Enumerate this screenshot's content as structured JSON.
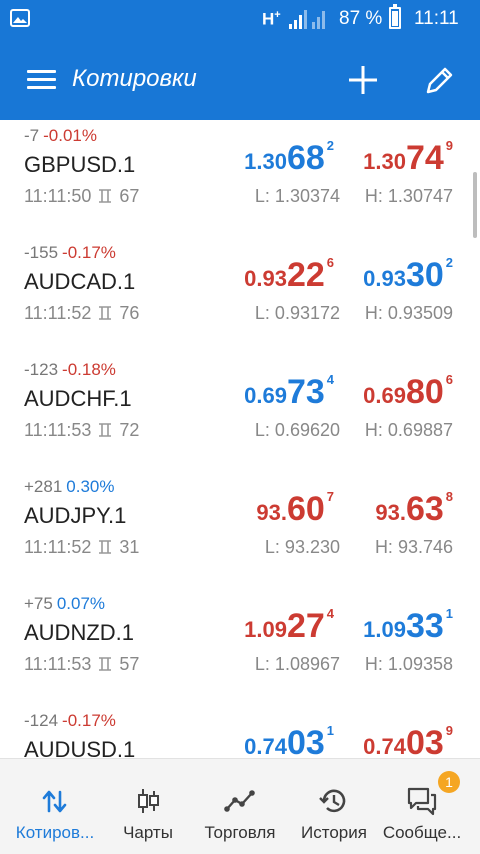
{
  "status_bar": {
    "network": "H",
    "network_plus": "+",
    "battery_percent": "87 %",
    "time": "11:11"
  },
  "toolbar": {
    "title": "Котировки",
    "icons": [
      "menu-icon",
      "plus-icon",
      "pencil-icon"
    ]
  },
  "quotes": [
    {
      "symbol": "GBPUSD.1",
      "change_points": "-7",
      "change_pct": "-0.01%",
      "change_dir": "down",
      "time": "11:11:50",
      "spread": "67",
      "bid": {
        "pre": "1.30",
        "big": "68",
        "sup": "2",
        "color": "blue"
      },
      "ask": {
        "pre": "1.30",
        "big": "74",
        "sup": "9",
        "color": "red"
      },
      "low": "L: 1.30374",
      "high": "H: 1.30747"
    },
    {
      "symbol": "AUDCAD.1",
      "change_points": "-155",
      "change_pct": "-0.17%",
      "change_dir": "down",
      "time": "11:11:52",
      "spread": "76",
      "bid": {
        "pre": "0.93",
        "big": "22",
        "sup": "6",
        "color": "red"
      },
      "ask": {
        "pre": "0.93",
        "big": "30",
        "sup": "2",
        "color": "blue"
      },
      "low": "L: 0.93172",
      "high": "H: 0.93509"
    },
    {
      "symbol": "AUDCHF.1",
      "change_points": "-123",
      "change_pct": "-0.18%",
      "change_dir": "down",
      "time": "11:11:53",
      "spread": "72",
      "bid": {
        "pre": "0.69",
        "big": "73",
        "sup": "4",
        "color": "blue"
      },
      "ask": {
        "pre": "0.69",
        "big": "80",
        "sup": "6",
        "color": "red"
      },
      "low": "L: 0.69620",
      "high": "H: 0.69887"
    },
    {
      "symbol": "AUDJPY.1",
      "change_points": "+281",
      "change_pct": "0.30%",
      "change_dir": "up",
      "time": "11:11:52",
      "spread": "31",
      "bid": {
        "pre": "93.",
        "big": "60",
        "sup": "7",
        "color": "red"
      },
      "ask": {
        "pre": "93.",
        "big": "63",
        "sup": "8",
        "color": "red"
      },
      "low": "L: 93.230",
      "high": "H: 93.746"
    },
    {
      "symbol": "AUDNZD.1",
      "change_points": "+75",
      "change_pct": "0.07%",
      "change_dir": "up",
      "time": "11:11:53",
      "spread": "57",
      "bid": {
        "pre": "1.09",
        "big": "27",
        "sup": "4",
        "color": "red"
      },
      "ask": {
        "pre": "1.09",
        "big": "33",
        "sup": "1",
        "color": "blue"
      },
      "low": "L: 1.08967",
      "high": "H: 1.09358"
    },
    {
      "symbol": "AUDUSD.1",
      "change_points": "-124",
      "change_pct": "-0.17%",
      "change_dir": "down",
      "time": "",
      "spread": "",
      "bid": {
        "pre": "0.74",
        "big": "03",
        "sup": "1",
        "color": "blue"
      },
      "ask": {
        "pre": "0.74",
        "big": "03",
        "sup": "9",
        "color": "red"
      },
      "low": "",
      "high": ""
    }
  ],
  "tabs": [
    {
      "label": "Котиров...",
      "icon": "quotes-arrows-icon",
      "active": true
    },
    {
      "label": "Чарты",
      "icon": "candlestick-icon",
      "active": false
    },
    {
      "label": "Торговля",
      "icon": "trade-line-icon",
      "active": false
    },
    {
      "label": "История",
      "icon": "history-clock-icon",
      "active": false
    },
    {
      "label": "Сообще...",
      "icon": "messages-icon",
      "active": false,
      "badge": "1"
    }
  ],
  "colors": {
    "brand": "#1877d6",
    "up": "#1e7bd9",
    "down": "#cc3b32",
    "badge": "#f5a623"
  }
}
